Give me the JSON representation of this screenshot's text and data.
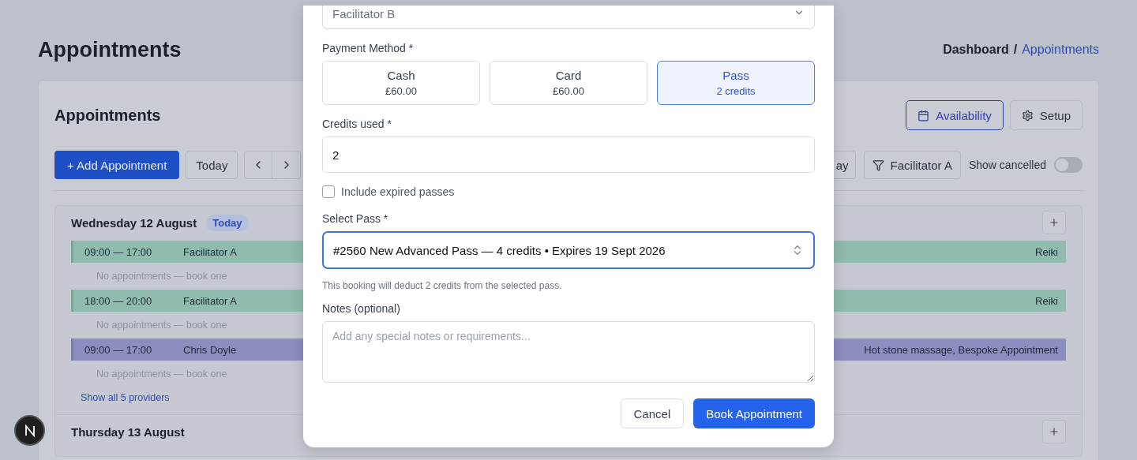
{
  "page": {
    "title": "Appointments",
    "breadcrumb": [
      {
        "label": "Dashboard",
        "selected": false
      },
      {
        "label": "Appointments",
        "selected": true
      }
    ],
    "separator": "/"
  },
  "card": {
    "title": "Appointments",
    "actions": [
      {
        "label": "Availability",
        "selected": true
      },
      {
        "label": "Setup",
        "selected": false
      }
    ]
  },
  "toolbar": {
    "add_button": "+ Add Appointment",
    "today_button": "Today",
    "view_button": "ay",
    "filter_button": "Facilitator A",
    "show_cancelled": {
      "label": "Show cancelled",
      "on": false
    }
  },
  "days": [
    {
      "title": "Wednesday 12 August",
      "badge": "Today",
      "slots": [
        {
          "time": "09:00 — 17:00",
          "provider": "Facilitator A",
          "services": "Reiki",
          "color": "#8fbcae",
          "empty_text": "No appointments — book one"
        },
        {
          "time": "18:00 — 20:00",
          "provider": "Facilitator A",
          "services": "Reiki",
          "color": "#8fbcae",
          "empty_text": "No appointments — book one"
        },
        {
          "time": "09:00 — 17:00",
          "provider": "Chris Doyle",
          "services": "Hot stone massage, Bespoke Appointment",
          "color": "#8a8fc0",
          "empty_text": "No appointments — book one"
        }
      ],
      "more_link": "Show all 5 providers"
    },
    {
      "title": "Thursday 13 August"
    }
  ],
  "modal": {
    "facilitator": {
      "value": "Facilitator B"
    },
    "payment": {
      "label": "Payment Method *",
      "options": [
        {
          "title": "Cash",
          "detail": "£60.00",
          "selected": false
        },
        {
          "title": "Card",
          "detail": "£60.00",
          "selected": false
        },
        {
          "title": "Pass",
          "detail": "2 credits",
          "selected": true
        }
      ]
    },
    "credits": {
      "label": "Credits used *",
      "value": "2"
    },
    "include_expired": {
      "label": "Include expired passes",
      "checked": false
    },
    "pass": {
      "label": "Select Pass *",
      "value": "#2560 New Advanced Pass — 4 credits • Expires 19 Sept 2026",
      "help": "This booking will deduct 2 credits from the selected pass."
    },
    "notes": {
      "label": "Notes (optional)",
      "placeholder": "Add any special notes or requirements..."
    },
    "buttons": [
      {
        "label": "Cancel",
        "kind": "secondary"
      },
      {
        "label": "Book Appointment",
        "kind": "primary"
      }
    ]
  }
}
